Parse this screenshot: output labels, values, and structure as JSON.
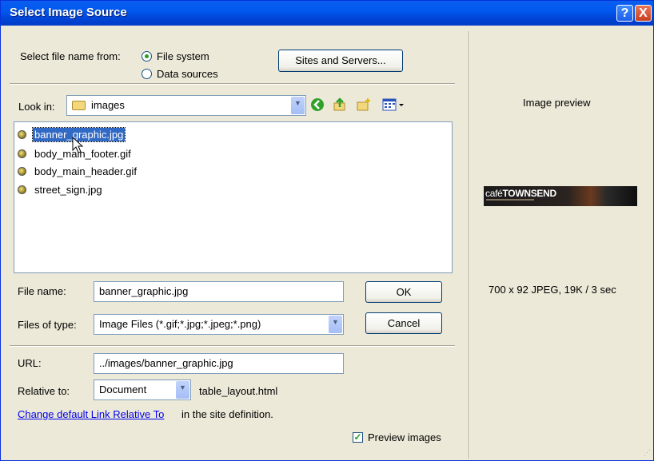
{
  "window": {
    "title": "Select Image Source",
    "help_icon": "?",
    "close_icon": "X"
  },
  "source": {
    "label": "Select file name from:",
    "options": [
      {
        "label": "File system",
        "selected": true
      },
      {
        "label": "Data sources",
        "selected": false
      }
    ],
    "sites_button": "Sites and Servers..."
  },
  "lookin": {
    "label": "Look in:",
    "folder": "images"
  },
  "toolbar": {
    "icons": [
      "back-icon",
      "up-folder-icon",
      "new-folder-icon",
      "view-menu-icon"
    ]
  },
  "files": [
    {
      "name": "banner_graphic.jpg",
      "selected": true
    },
    {
      "name": "body_main_footer.gif",
      "selected": false
    },
    {
      "name": "body_main_header.gif",
      "selected": false
    },
    {
      "name": "street_sign.jpg",
      "selected": false
    }
  ],
  "filename": {
    "label": "File name:",
    "value": "banner_graphic.jpg"
  },
  "filetype": {
    "label": "Files of type:",
    "value": "Image Files (*.gif;*.jpg;*.jpeg;*.png)"
  },
  "buttons": {
    "ok": "OK",
    "cancel": "Cancel"
  },
  "url": {
    "label": "URL:",
    "value": "../images/banner_graphic.jpg"
  },
  "relative": {
    "label": "Relative to:",
    "value": "Document",
    "file": "table_layout.html"
  },
  "link": {
    "text": "Change default Link Relative To",
    "suffix": "in the site definition."
  },
  "preview_check": {
    "label": "Preview images",
    "checked": true
  },
  "preview": {
    "title": "Image preview",
    "image_brand_prefix": "café",
    "image_brand_name": "TOWNSEND",
    "info": "700 x 92 JPEG, 19K / 3 sec"
  },
  "colors": {
    "titlebar": "#0058EE",
    "dialog_bg": "#ECE9D8",
    "selection": "#316AC5",
    "link": "#0000EE"
  }
}
